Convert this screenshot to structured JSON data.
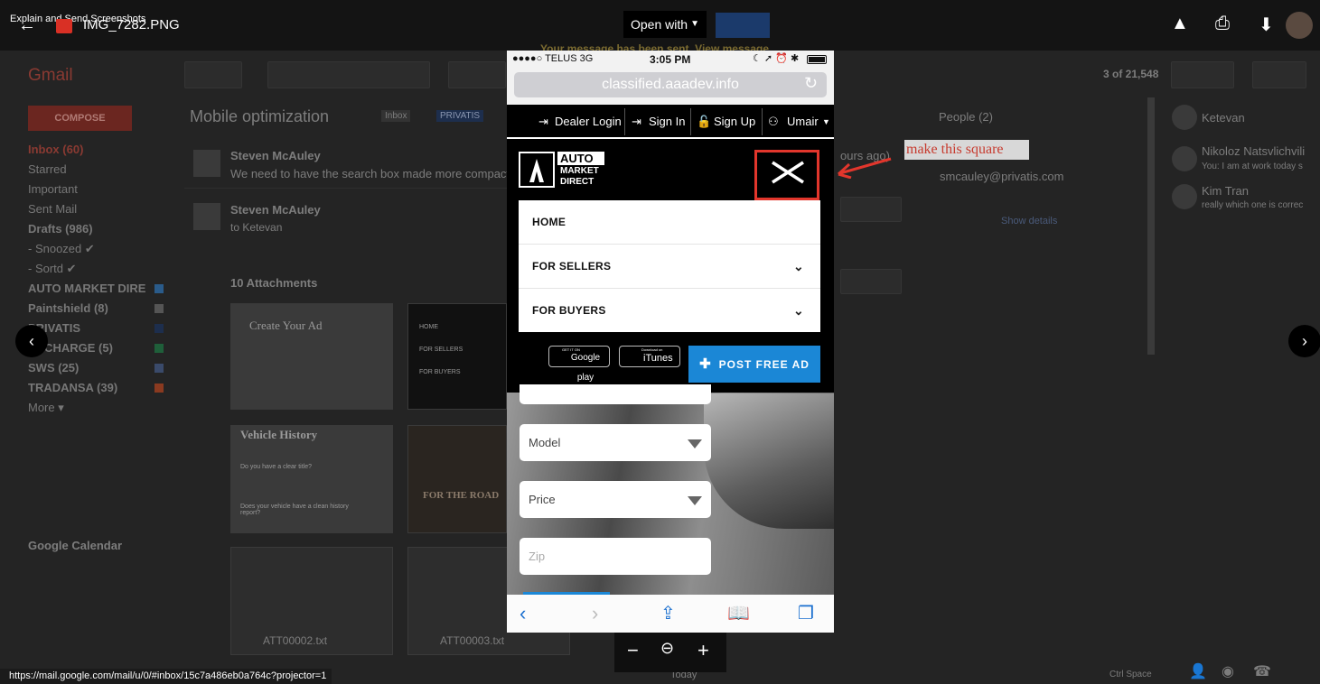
{
  "viewer": {
    "window_title": "Explain and Send Screenshots",
    "filename": "IMG_7282.PNG",
    "open_with": "Open with",
    "status_url": "https://mail.google.com/mail/u/0/#inbox/15c7a486eb0a764c?projector=1",
    "banner": "Your message has been sent. View message"
  },
  "gmail": {
    "logo": "Gmail",
    "compose": "COMPOSE",
    "sidebar": [
      {
        "label": "Inbox (60)",
        "bold": true
      },
      {
        "label": "Starred",
        "bold": false
      },
      {
        "label": "Important",
        "bold": false
      },
      {
        "label": "Sent Mail",
        "bold": false
      },
      {
        "label": "Drafts (986)",
        "bold": true
      },
      {
        "label": "- Snoozed ✔",
        "bold": false
      },
      {
        "label": "- Sortd ✔",
        "bold": false
      },
      {
        "label": "AUTO MARKET DIRE",
        "bold": true
      },
      {
        "label": "Paintshield (8)",
        "bold": true
      },
      {
        "label": "PRIVATIS",
        "bold": true
      },
      {
        "label": "RECHARGE (5)",
        "bold": true
      },
      {
        "label": "SWS (25)",
        "bold": true
      },
      {
        "label": "TRADANSA (39)",
        "bold": true
      },
      {
        "label": "More ▾",
        "bold": false
      }
    ],
    "google_calendar": "Google Calendar",
    "subject": "Mobile optimization",
    "label_inbox": "Inbox",
    "label_privatis": "PRIVATIS",
    "count": "3 of 21,548",
    "messages": [
      {
        "from": "Steven McAuley",
        "snippet": "We need to have the search box made more compact"
      },
      {
        "from": "Steven McAuley",
        "snippet": "to Ketevan"
      }
    ],
    "attachments_title": "10 Attachments",
    "thumb_titles": [
      "Create Your Ad",
      "Vehicle History"
    ],
    "thumb_text": [
      "HOME",
      "FOR SELLERS",
      "FOR BUYERS",
      "FOR THE ROAD"
    ],
    "vh_questions": [
      "Do you have a clear title?",
      "Does your vehicle have a clean history report?"
    ],
    "files": [
      "ATT00002.txt",
      "ATT00003.txt"
    ],
    "time_snippet": "ours ago)",
    "people_header": "People (2)",
    "people_email": "smcauley@privatis.com",
    "show_details": "Show details",
    "hangouts_user": "Ketevan",
    "chats": [
      {
        "name": "Nikoloz Natsvlichvili",
        "snippet": "You: I am at work today s"
      },
      {
        "name": "Kim Tran",
        "snippet": "really which one is correc"
      }
    ],
    "footer_today": "Today",
    "footer_ctrl": "Ctrl Space"
  },
  "phone": {
    "carrier": "●●●●○ TELUS  3G",
    "time": "3:05 PM",
    "url": "classified.aaadev.info",
    "nav": {
      "dealer_login": "Dealer Login",
      "sign_in": "Sign In",
      "sign_up": "Sign Up",
      "user": "Umair"
    },
    "logo_line1": "AUTO",
    "logo_line2": "MARKET",
    "logo_line3": "DIRECT",
    "menu": [
      {
        "label": "HOME",
        "has_chevron": false
      },
      {
        "label": "FOR SELLERS",
        "has_chevron": true
      },
      {
        "label": "FOR BUYERS",
        "has_chevron": true
      }
    ],
    "google_play": "Google play",
    "google_play_small": "GET IT ON",
    "itunes": "iTunes",
    "itunes_small": "Download on",
    "post_ad": "POST FREE AD",
    "fields": [
      {
        "label": "Model",
        "dropdown": true
      },
      {
        "label": "Price",
        "dropdown": true
      },
      {
        "label": "Zip",
        "dropdown": false
      }
    ]
  },
  "annotation": {
    "text": "make this square",
    "color": "#e2362c"
  }
}
